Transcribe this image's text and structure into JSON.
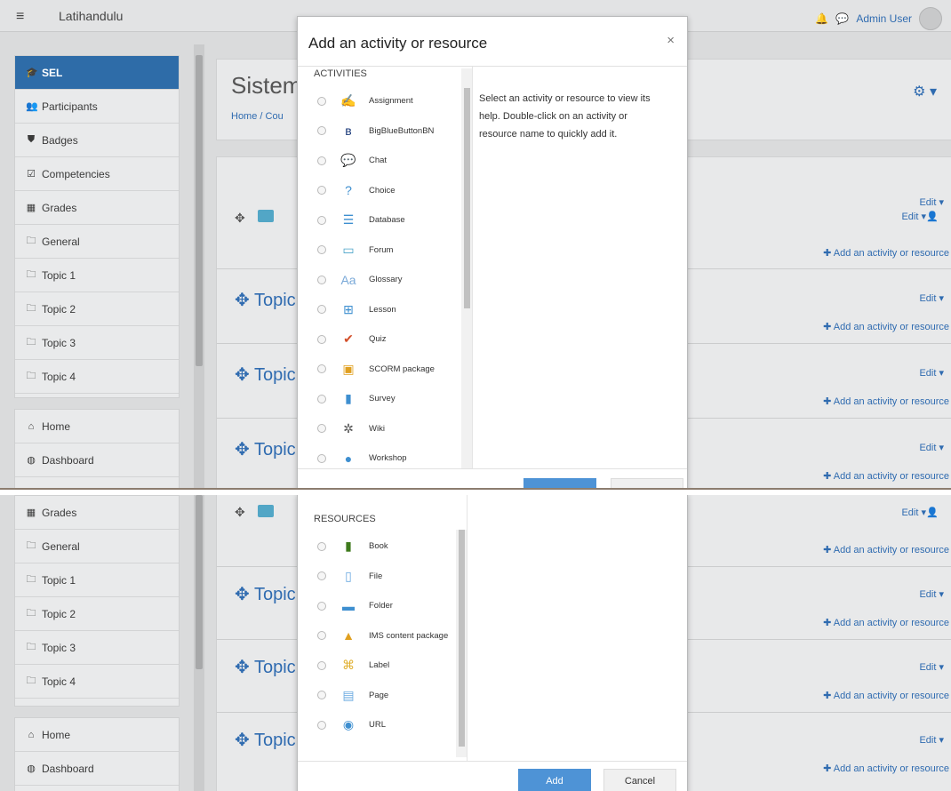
{
  "header": {
    "app_title": "Latihandulu",
    "user_name": "Admin User"
  },
  "sidebar": {
    "course": "SEL",
    "items": [
      "Participants",
      "Badges",
      "Competencies",
      "Grades",
      "General",
      "Topic 1",
      "Topic 2",
      "Topic 3",
      "Topic 4"
    ],
    "nav": [
      "Home",
      "Dashboard"
    ]
  },
  "course_page": {
    "site_name": "Sistem",
    "breadcrumb": "Home / Cou",
    "topic_label": "Topic",
    "edit_label": "Edit ▾",
    "add_activity_label": "✚ Add an activity or resource"
  },
  "modal": {
    "title": "Add an activity or resource",
    "close_label": "×",
    "activities_header": "ACTIVITIES",
    "resources_header": "RESOURCES",
    "help_text": "Select an activity or resource to view its help. Double-click on an activity or resource name to quickly add it.",
    "activities": [
      {
        "label": "Assignment",
        "icon": "assignment-icon"
      },
      {
        "label": "BigBlueButtonBN",
        "icon": "bigbluebutton-icon"
      },
      {
        "label": "Chat",
        "icon": "chat-icon"
      },
      {
        "label": "Choice",
        "icon": "choice-icon"
      },
      {
        "label": "Database",
        "icon": "database-icon"
      },
      {
        "label": "Forum",
        "icon": "forum-icon"
      },
      {
        "label": "Glossary",
        "icon": "glossary-icon"
      },
      {
        "label": "Lesson",
        "icon": "lesson-icon"
      },
      {
        "label": "Quiz",
        "icon": "quiz-icon"
      },
      {
        "label": "SCORM package",
        "icon": "scorm-icon"
      },
      {
        "label": "Survey",
        "icon": "survey-icon"
      },
      {
        "label": "Wiki",
        "icon": "wiki-icon"
      },
      {
        "label": "Workshop",
        "icon": "workshop-icon"
      }
    ],
    "resources": [
      {
        "label": "Book",
        "icon": "book-icon"
      },
      {
        "label": "File",
        "icon": "file-icon"
      },
      {
        "label": "Folder",
        "icon": "folder-icon"
      },
      {
        "label": "IMS content package",
        "icon": "ims-package-icon"
      },
      {
        "label": "Label",
        "icon": "label-icon"
      },
      {
        "label": "Page",
        "icon": "page-icon"
      },
      {
        "label": "URL",
        "icon": "url-icon"
      }
    ],
    "add_button": "Add",
    "cancel_button": "Cancel"
  }
}
